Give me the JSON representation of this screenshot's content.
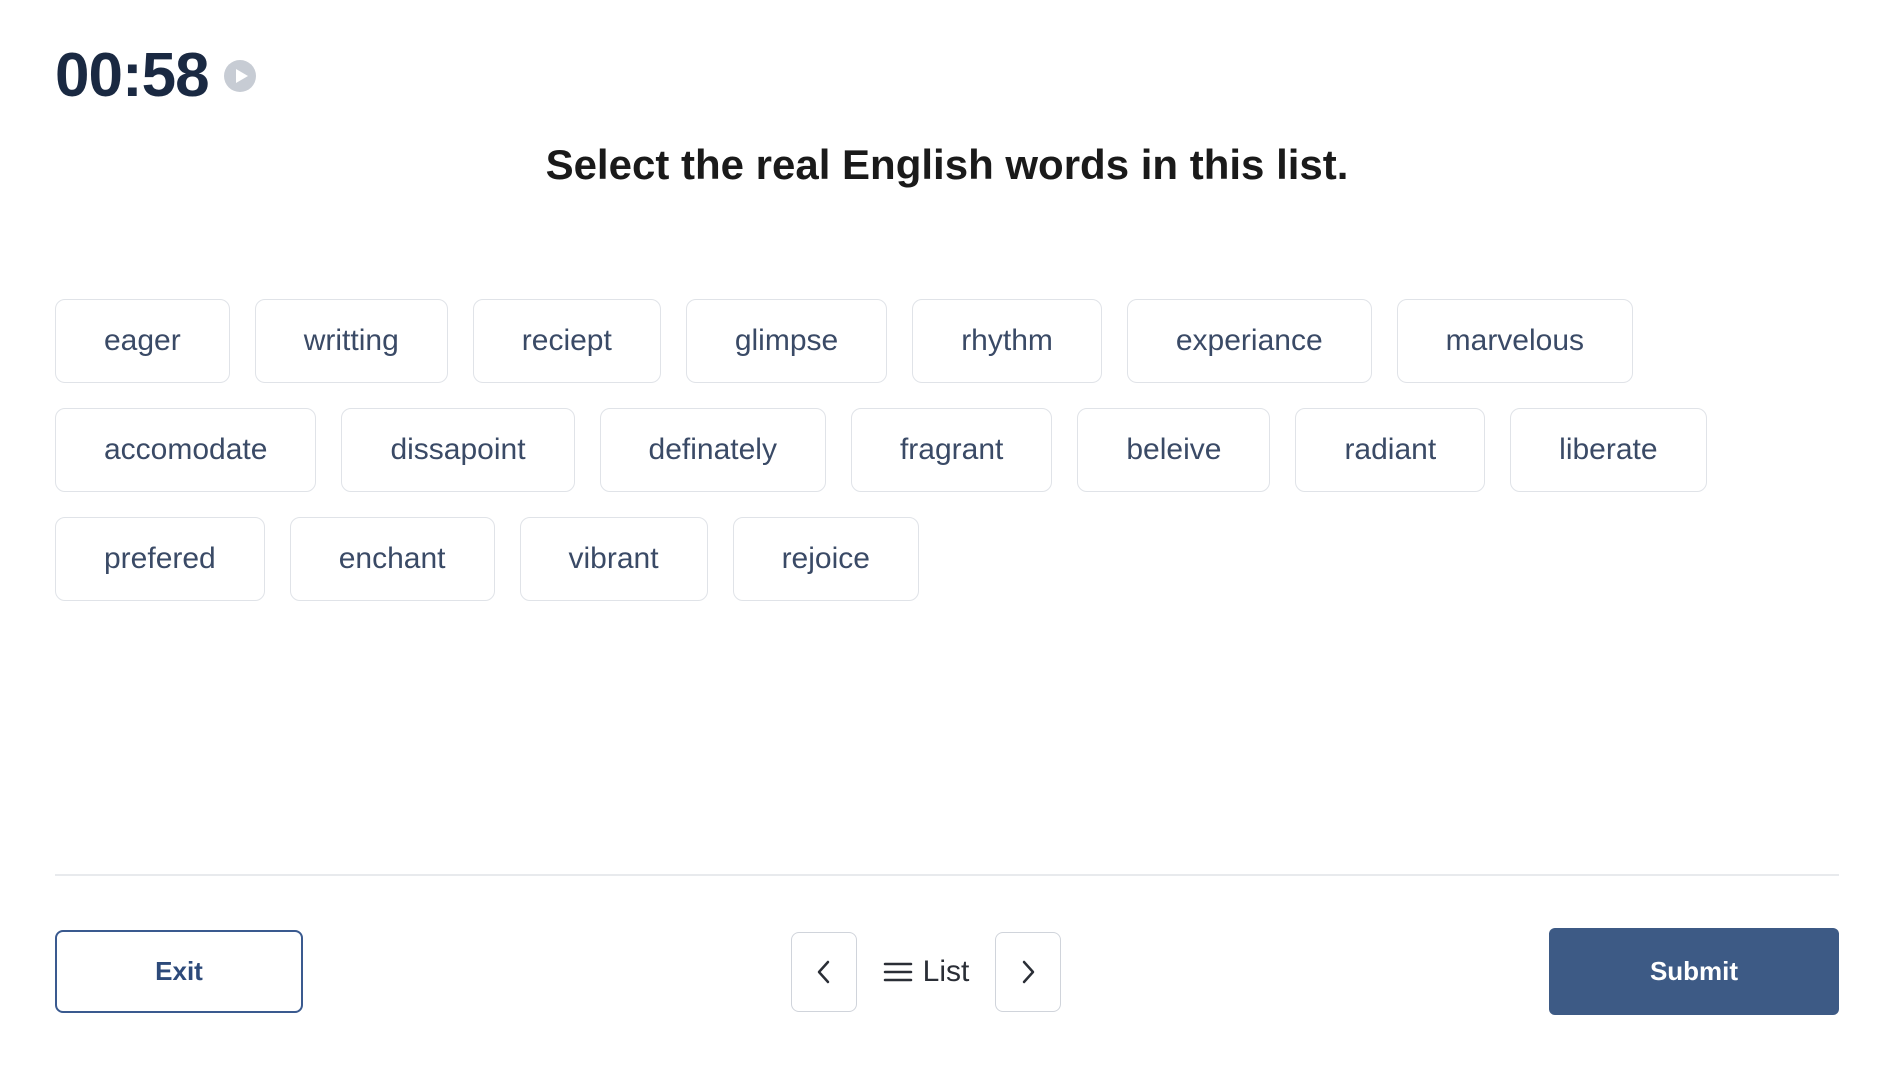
{
  "timer": "00:58",
  "question": "Select the real English words in this list.",
  "words": [
    "eager",
    "writting",
    "reciept",
    "glimpse",
    "rhythm",
    "experiance",
    "marvelous",
    "accomodate",
    "dissapoint",
    "definately",
    "fragrant",
    "beleive",
    "radiant",
    "liberate",
    "prefered",
    "enchant",
    "vibrant",
    "rejoice"
  ],
  "footer": {
    "exit_label": "Exit",
    "list_label": "List",
    "submit_label": "Submit"
  }
}
